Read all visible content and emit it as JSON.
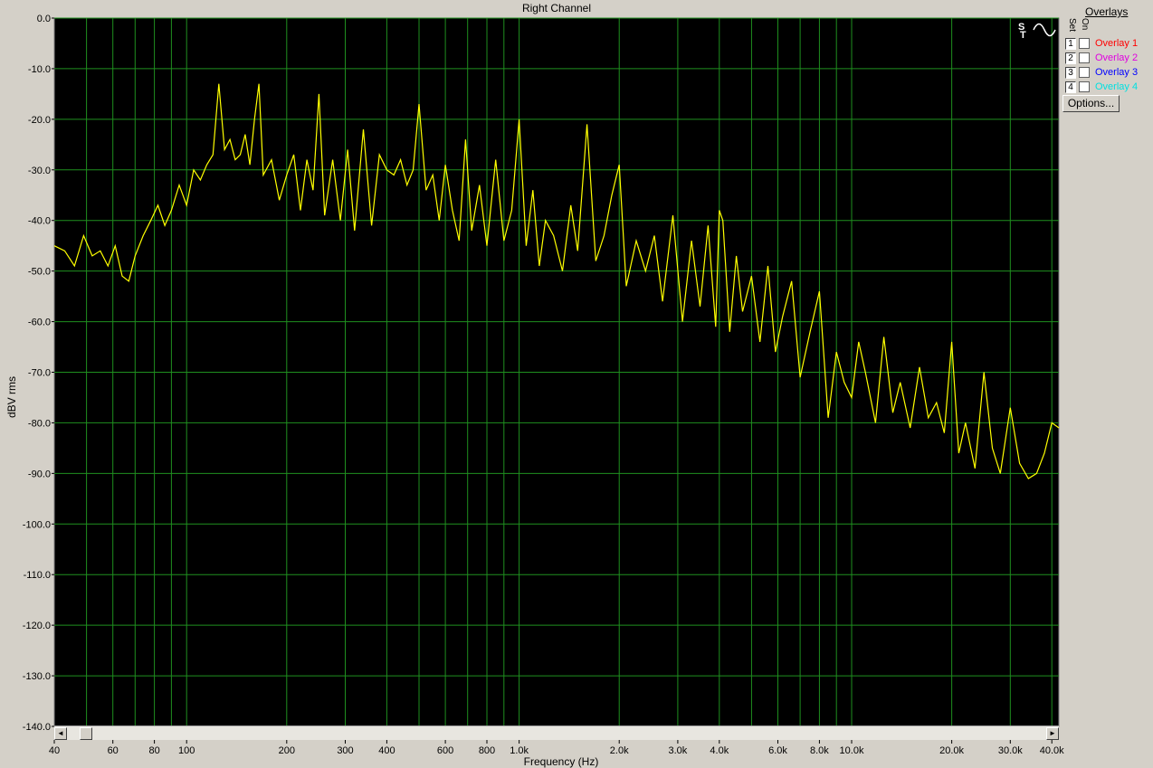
{
  "chart_data": {
    "type": "line",
    "title": "Right Channel",
    "xlabel": "Frequency (Hz)",
    "ylabel": "dBV rms",
    "x_scale": "log",
    "xlim": [
      40,
      42000
    ],
    "ylim": [
      -140,
      0
    ],
    "grid": true,
    "background": "#000000",
    "grid_color": "#1f8f1f",
    "line_color": "#ffff00",
    "x_ticks": [
      40,
      60,
      80,
      100,
      200,
      300,
      400,
      600,
      800,
      1000,
      2000,
      3000,
      4000,
      6000,
      8000,
      10000,
      20000,
      30000,
      40000
    ],
    "x_tick_labels": [
      "40",
      "60",
      "80",
      "100",
      "200",
      "300",
      "400",
      "600",
      "800",
      "1.0k",
      "2.0k",
      "3.0k",
      "4.0k",
      "6.0k",
      "8.0k",
      "10.0k",
      "20.0k",
      "30.0k",
      "40.0k"
    ],
    "y_ticks": [
      0,
      -10,
      -20,
      -30,
      -40,
      -50,
      -60,
      -70,
      -80,
      -90,
      -100,
      -110,
      -120,
      -130,
      -140
    ],
    "y_tick_labels": [
      "0.0",
      "-10.0",
      "-20.0",
      "-30.0",
      "-40.0",
      "-50.0",
      "-60.0",
      "-70.0",
      "-80.0",
      "-90.0",
      "-100.0",
      "-110.0",
      "-120.0",
      "-130.0",
      "-140.0"
    ],
    "series": [
      {
        "x": [
          40,
          43,
          46,
          49,
          52,
          55,
          58,
          61,
          64,
          67,
          70,
          74,
          78,
          82,
          86,
          90,
          95,
          100,
          105,
          110,
          115,
          120,
          125,
          130,
          135,
          140,
          145,
          150,
          155,
          160,
          165,
          170,
          180,
          190,
          200,
          210,
          220,
          230,
          240,
          250,
          260,
          275,
          290,
          305,
          320,
          340,
          360,
          380,
          400,
          420,
          440,
          460,
          480,
          500,
          525,
          550,
          575,
          600,
          630,
          660,
          690,
          720,
          760,
          800,
          850,
          900,
          950,
          1000,
          1050,
          1100,
          1150,
          1200,
          1270,
          1350,
          1430,
          1500,
          1600,
          1700,
          1800,
          1900,
          2000,
          2100,
          2250,
          2400,
          2550,
          2700,
          2900,
          3100,
          3300,
          3500,
          3700,
          3900,
          4000,
          4100,
          4300,
          4500,
          4700,
          5000,
          5300,
          5600,
          5900,
          6200,
          6600,
          7000,
          7500,
          8000,
          8500,
          9000,
          9500,
          10000,
          10500,
          11000,
          11800,
          12500,
          13300,
          14000,
          15000,
          16000,
          17000,
          18000,
          19000,
          20000,
          21000,
          22000,
          23500,
          25000,
          26500,
          28000,
          30000,
          32000,
          34000,
          36000,
          38000,
          40000,
          42000
        ],
        "y": [
          -45,
          -46,
          -49,
          -43,
          -47,
          -46,
          -49,
          -45,
          -51,
          -52,
          -47,
          -43,
          -40,
          -37,
          -41,
          -38,
          -33,
          -37,
          -30,
          -32,
          -29,
          -27,
          -13,
          -26,
          -24,
          -28,
          -27,
          -23,
          -29,
          -20,
          -13,
          -31,
          -28,
          -36,
          -31,
          -27,
          -38,
          -28,
          -34,
          -15,
          -39,
          -28,
          -40,
          -26,
          -42,
          -22,
          -41,
          -27,
          -30,
          -31,
          -28,
          -33,
          -30,
          -17,
          -34,
          -31,
          -40,
          -29,
          -38,
          -44,
          -24,
          -42,
          -33,
          -45,
          -28,
          -44,
          -38,
          -20,
          -45,
          -34,
          -49,
          -40,
          -43,
          -50,
          -37,
          -46,
          -21,
          -48,
          -43,
          -35,
          -29,
          -53,
          -44,
          -50,
          -43,
          -56,
          -39,
          -60,
          -44,
          -57,
          -41,
          -61,
          -38,
          -40,
          -62,
          -47,
          -58,
          -51,
          -64,
          -49,
          -66,
          -59,
          -52,
          -71,
          -62,
          -54,
          -79,
          -66,
          -72,
          -75,
          -64,
          -70,
          -80,
          -63,
          -78,
          -72,
          -81,
          -69,
          -79,
          -76,
          -82,
          -64,
          -86,
          -80,
          -89,
          -70,
          -85,
          -90,
          -77,
          -88,
          -91,
          -90,
          -86,
          -80,
          -81
        ]
      }
    ]
  },
  "overlays_panel": {
    "title": "Overlays",
    "set_label": "Set",
    "on_label": "On",
    "items": [
      {
        "num": "1",
        "label": "Overlay 1",
        "color": "#ff0000"
      },
      {
        "num": "2",
        "label": "Overlay 2",
        "color": "#e000e0"
      },
      {
        "num": "3",
        "label": "Overlay 3",
        "color": "#0000ff"
      },
      {
        "num": "4",
        "label": "Overlay 4",
        "color": "#00e0e0"
      }
    ],
    "options_label": "Options...",
    "icon": "st-sine-icon"
  },
  "scrollbar": {
    "left_arrow": "◄",
    "right_arrow": "►"
  }
}
